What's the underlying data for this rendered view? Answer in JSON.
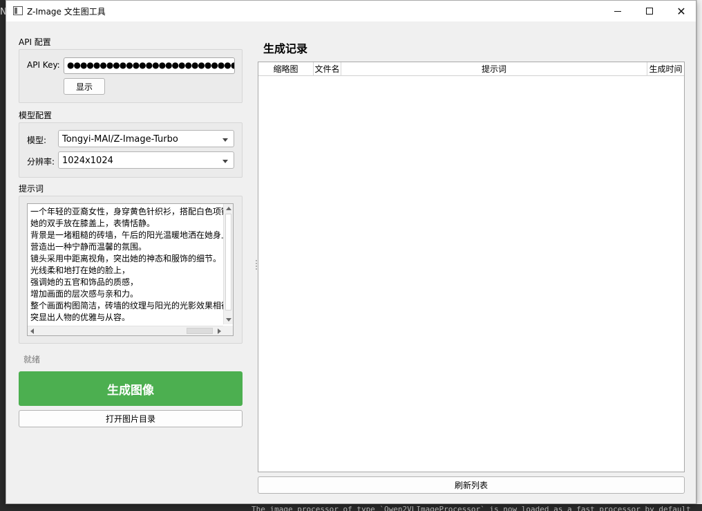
{
  "window": {
    "title": "Z-Image 文生图工具"
  },
  "api_config": {
    "section_title": "API 配置",
    "key_label": "API Key:",
    "key_value": "●●●●●●●●●●●●●●●●●●●●●●●●●●●●●●●●●",
    "show_button": "显示"
  },
  "model_config": {
    "section_title": "模型配置",
    "model_label": "模型:",
    "model_value": "Tongyi-MAI/Z-Image-Turbo",
    "resolution_label": "分辨率:",
    "resolution_value": "1024x1024"
  },
  "prompt": {
    "section_title": "提示词",
    "text": "一个年轻的亚裔女性，身穿黄色针织衫，搭配白色项链\n她的双手放在膝盖上，表情恬静。\n背景是一堵粗糙的砖墙，午后的阳光温暖地洒在她身上\n营造出一种宁静而温馨的氛围。\n镜头采用中距离视角，突出她的神态和服饰的细节。\n光线柔和地打在她的脸上，\n强调她的五官和饰品的质感，\n增加画面的层次感与亲和力。\n整个画面构图简洁，砖墙的纹理与阳光的光影效果相得\n突显出人物的优雅与从容。"
  },
  "status": {
    "text": "就绪"
  },
  "actions": {
    "generate": "生成图像",
    "open_folder": "打开图片目录",
    "refresh": "刷新列表"
  },
  "records": {
    "title": "生成记录",
    "columns": [
      "缩略图",
      "文件名",
      "提示词",
      "生成时间"
    ],
    "rows": []
  },
  "background": {
    "left_char": "N",
    "terminal_text": "The image processor of type `Qwen2VLImageProcessor` is now loaded as a fast processor by default"
  },
  "colors": {
    "primary": "#4caf50",
    "window_bg": "#f0f0f0"
  }
}
